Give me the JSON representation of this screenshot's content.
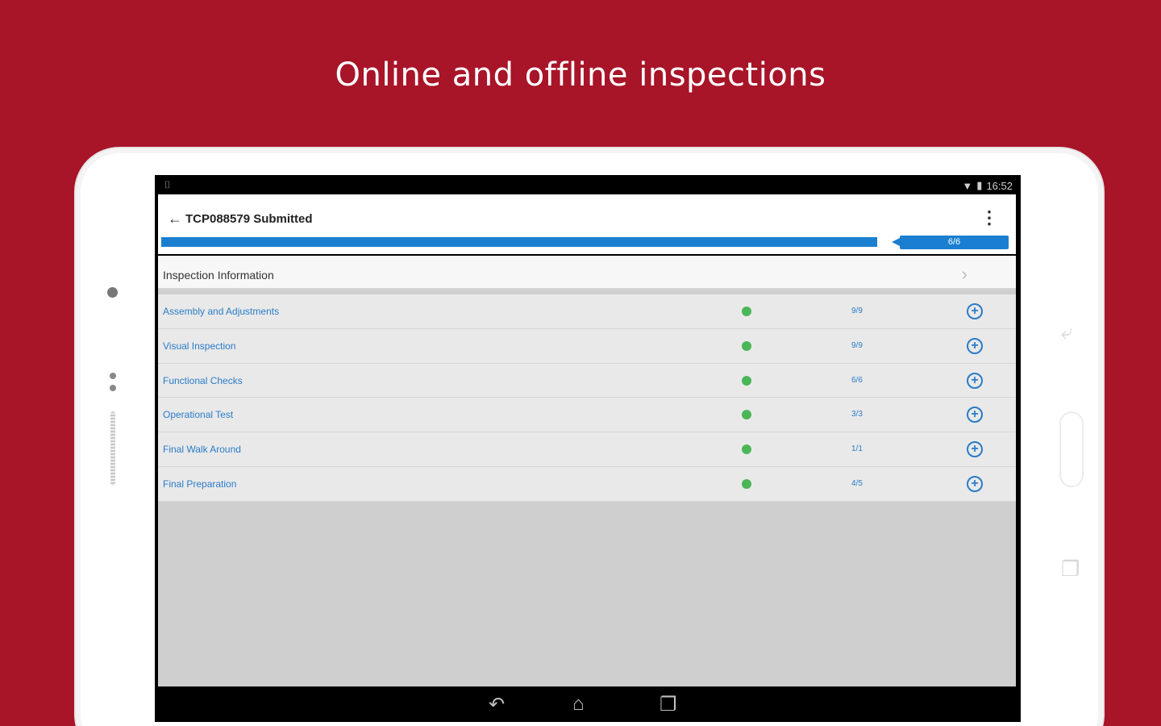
{
  "headline": "Online and offline inspections",
  "statusbar": {
    "time": "16:52",
    "left_icon": "android-debug-icon",
    "wifi_icon": "wifi-icon",
    "battery_icon": "battery-icon"
  },
  "appbar": {
    "title": "TCP088579 Submitted",
    "back_icon": "arrow-back-icon",
    "menu_icon": "more-vert-icon"
  },
  "progress": {
    "badge": "6/6",
    "fraction": 1.0,
    "color": "#1a7fd0"
  },
  "section": {
    "label": "Inspection Information"
  },
  "rows": [
    {
      "label": "Assembly and Adjustments",
      "count": "9/9"
    },
    {
      "label": "Visual Inspection",
      "count": "9/9"
    },
    {
      "label": "Functional Checks",
      "count": "6/6"
    },
    {
      "label": "Operational Test",
      "count": "3/3"
    },
    {
      "label": "Final Walk Around",
      "count": "1/1"
    },
    {
      "label": "Final Preparation",
      "count": "4/5"
    }
  ],
  "colors": {
    "brand_red": "#a81428",
    "accent_blue": "#1a7fd0",
    "complete_green": "#4bb657"
  }
}
